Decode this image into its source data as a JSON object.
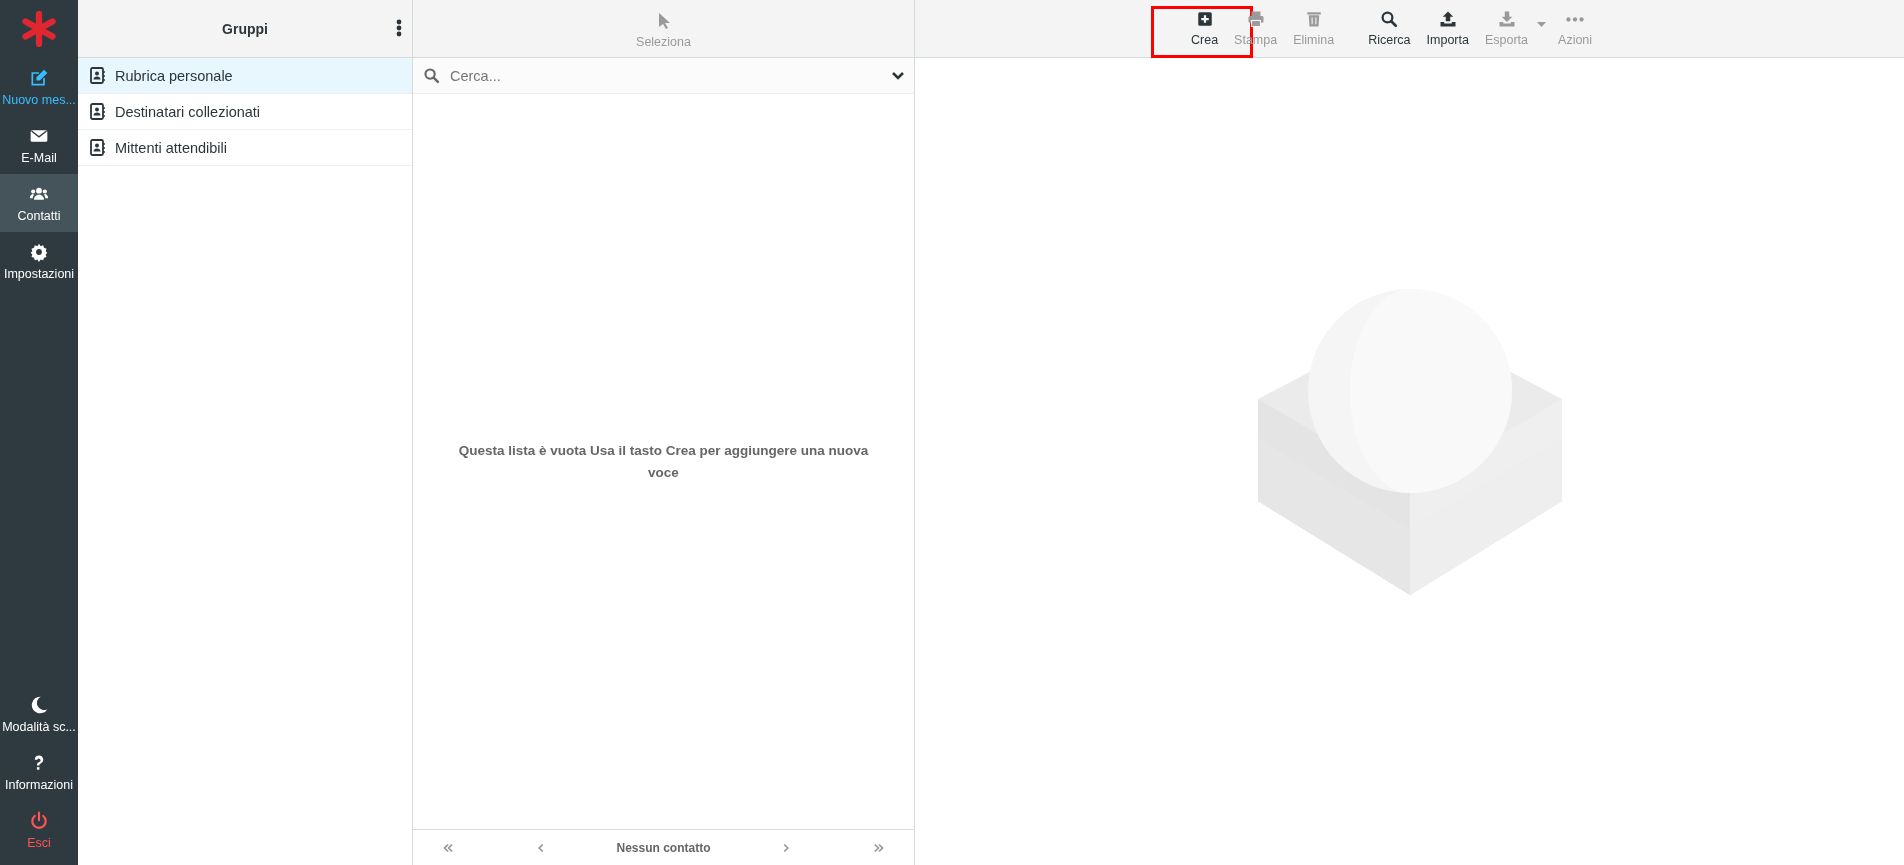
{
  "sidebar": {
    "top_items": [
      {
        "label": "Nuovo mes...",
        "kind": "accent",
        "selected": false
      },
      {
        "label": "E-Mail",
        "kind": "normal",
        "selected": false
      },
      {
        "label": "Contatti",
        "kind": "normal",
        "selected": true
      },
      {
        "label": "Impostazioni",
        "kind": "normal",
        "selected": false
      }
    ],
    "bottom_items": [
      {
        "label": "Modalità sc...",
        "kind": "normal",
        "selected": false
      },
      {
        "label": "Informazioni",
        "kind": "normal",
        "selected": false
      },
      {
        "label": "Esci",
        "kind": "danger",
        "selected": false
      }
    ]
  },
  "groups": {
    "title": "Gruppi",
    "items": [
      {
        "label": "Rubrica personale",
        "selected": true
      },
      {
        "label": "Destinatari collezionati",
        "selected": false
      },
      {
        "label": "Mittenti attendibili",
        "selected": false
      }
    ]
  },
  "list": {
    "select_button": {
      "label": "Seleziona",
      "disabled": true
    },
    "search": {
      "placeholder": "Cerca..."
    },
    "empty_message": "Questa lista è vuota Usa il tasto Crea per aggiungere una nuova voce",
    "pager": {
      "status": "Nessun contatto",
      "buttons": [
        {
          "disabled": true
        },
        {
          "disabled": true
        },
        {
          "disabled": true
        },
        {
          "disabled": true
        }
      ]
    }
  },
  "toolbar": {
    "buttons": [
      {
        "label": "Crea",
        "disabled": false,
        "highlighted": true
      },
      {
        "label": "Stampa",
        "disabled": true,
        "highlighted": false
      },
      {
        "label": "Elimina",
        "disabled": true,
        "highlighted": false
      },
      {
        "label": "Ricerca",
        "disabled": false,
        "highlighted": false
      },
      {
        "label": "Importa",
        "disabled": false,
        "highlighted": false
      },
      {
        "label": "Esporta",
        "disabled": true,
        "highlighted": false
      },
      {
        "label": "Azioni",
        "disabled": true,
        "highlighted": false
      }
    ]
  }
}
